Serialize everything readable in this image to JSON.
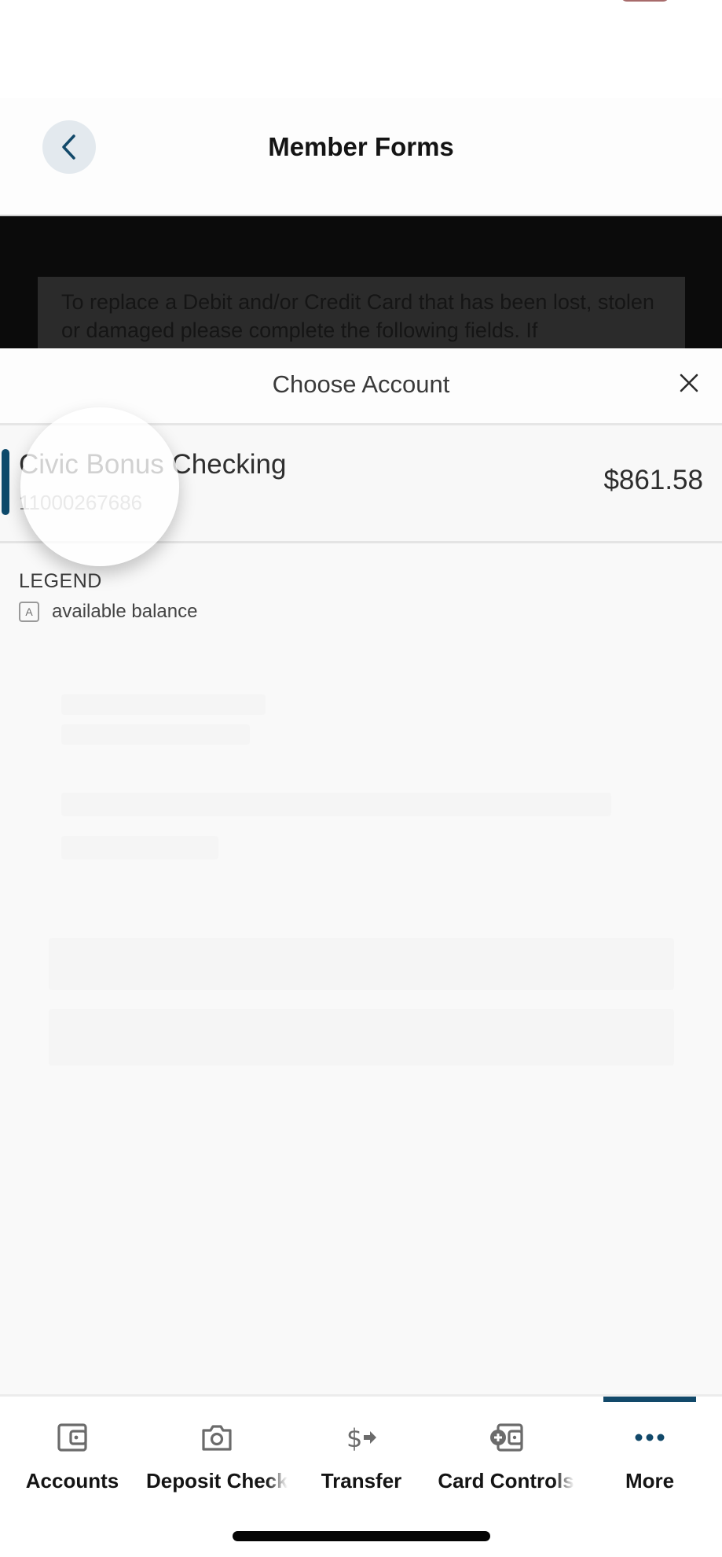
{
  "header": {
    "title": "Member Forms",
    "back_icon": "chevron-left-icon"
  },
  "underlying_content": {
    "intro_text": "To replace a Debit and/or Credit Card that has been lost, stolen or damaged please complete the following fields. If"
  },
  "sheet": {
    "title": "Choose Account",
    "close_icon": "close-icon",
    "accounts": [
      {
        "name": "Civic Bonus Checking",
        "number": "11000267686",
        "balance": "$861.58",
        "selected": true
      }
    ],
    "legend": {
      "title": "LEGEND",
      "items": [
        {
          "badge": "A",
          "label": "available balance"
        }
      ]
    }
  },
  "bottom_nav": {
    "items": [
      {
        "label": "Accounts",
        "icon": "wallet-icon",
        "active": false
      },
      {
        "label": "Deposit Checks",
        "icon": "camera-icon",
        "active": false
      },
      {
        "label": "Transfer",
        "icon": "dollar-transfer-icon",
        "active": false
      },
      {
        "label": "Card Controls",
        "icon": "card-add-icon",
        "active": false
      },
      {
        "label": "More",
        "icon": "more-dots-icon",
        "active": true
      }
    ]
  },
  "colors": {
    "accent": "#12496a",
    "icon_gray": "#6b6b6b",
    "back_button_bg": "#e3e9ee"
  }
}
